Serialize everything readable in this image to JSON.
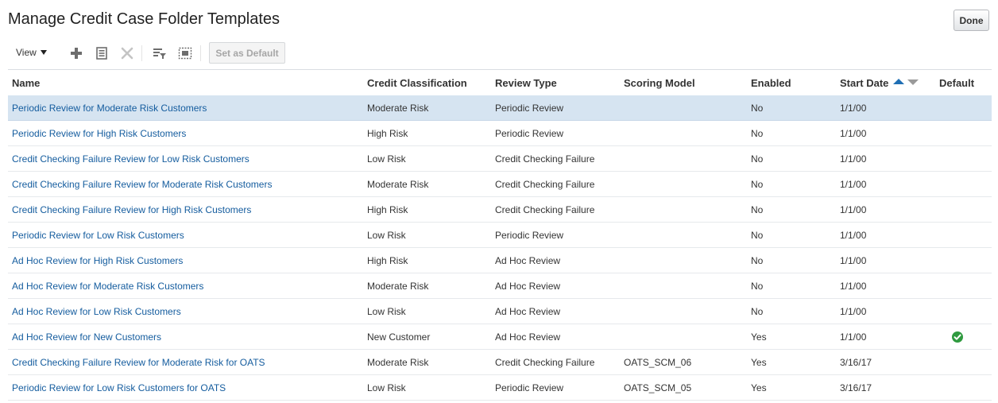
{
  "page": {
    "title": "Manage Credit Case Folder Templates",
    "done_label": "Done"
  },
  "toolbar": {
    "view_label": "View",
    "set_default_label": "Set as Default",
    "icons": [
      "add-icon",
      "edit-icon",
      "delete-icon",
      "query-by-example-icon",
      "detach-icon"
    ]
  },
  "table": {
    "columns": {
      "name": "Name",
      "classification": "Credit Classification",
      "review_type": "Review Type",
      "scoring_model": "Scoring Model",
      "enabled": "Enabled",
      "start_date": "Start Date",
      "default": "Default"
    },
    "sort": {
      "column": "start_date",
      "direction": "ascending"
    },
    "selected_row": 0,
    "rows": [
      {
        "name": "Periodic Review for Moderate Risk Customers",
        "classification": "Moderate Risk",
        "review_type": "Periodic Review",
        "scoring_model": "",
        "enabled": "No",
        "start_date": "1/1/00",
        "default": false
      },
      {
        "name": "Periodic Review for High Risk Customers",
        "classification": "High Risk",
        "review_type": "Periodic Review",
        "scoring_model": "",
        "enabled": "No",
        "start_date": "1/1/00",
        "default": false
      },
      {
        "name": "Credit Checking Failure Review for Low Risk Customers",
        "classification": "Low Risk",
        "review_type": "Credit Checking Failure",
        "scoring_model": "",
        "enabled": "No",
        "start_date": "1/1/00",
        "default": false
      },
      {
        "name": "Credit Checking Failure Review for Moderate Risk Customers",
        "classification": "Moderate Risk",
        "review_type": "Credit Checking Failure",
        "scoring_model": "",
        "enabled": "No",
        "start_date": "1/1/00",
        "default": false
      },
      {
        "name": "Credit Checking Failure Review for High Risk Customers",
        "classification": "High Risk",
        "review_type": "Credit Checking Failure",
        "scoring_model": "",
        "enabled": "No",
        "start_date": "1/1/00",
        "default": false
      },
      {
        "name": "Periodic Review for Low Risk Customers",
        "classification": "Low Risk",
        "review_type": "Periodic Review",
        "scoring_model": "",
        "enabled": "No",
        "start_date": "1/1/00",
        "default": false
      },
      {
        "name": "Ad Hoc Review for High Risk Customers",
        "classification": "High Risk",
        "review_type": "Ad Hoc Review",
        "scoring_model": "",
        "enabled": "No",
        "start_date": "1/1/00",
        "default": false
      },
      {
        "name": "Ad Hoc Review for Moderate Risk Customers",
        "classification": "Moderate Risk",
        "review_type": "Ad Hoc Review",
        "scoring_model": "",
        "enabled": "No",
        "start_date": "1/1/00",
        "default": false
      },
      {
        "name": "Ad Hoc Review for Low Risk Customers",
        "classification": "Low Risk",
        "review_type": "Ad Hoc Review",
        "scoring_model": "",
        "enabled": "No",
        "start_date": "1/1/00",
        "default": false
      },
      {
        "name": "Ad Hoc Review for New Customers",
        "classification": "New Customer",
        "review_type": "Ad Hoc Review",
        "scoring_model": "",
        "enabled": "Yes",
        "start_date": "1/1/00",
        "default": true
      },
      {
        "name": "Credit Checking Failure Review for Moderate Risk for OATS",
        "classification": "Moderate Risk",
        "review_type": "Credit Checking Failure",
        "scoring_model": "OATS_SCM_06",
        "enabled": "Yes",
        "start_date": "3/16/17",
        "default": false
      },
      {
        "name": "Periodic Review for Low Risk Customers for OATS",
        "classification": "Low Risk",
        "review_type": "Periodic Review",
        "scoring_model": "OATS_SCM_05",
        "enabled": "Yes",
        "start_date": "3/16/17",
        "default": false
      }
    ]
  },
  "colors": {
    "link": "#145c9e",
    "selected_row": "#d6e4f1",
    "sort_active": "#1f6fb4",
    "default_check": "#2f9a3f"
  }
}
